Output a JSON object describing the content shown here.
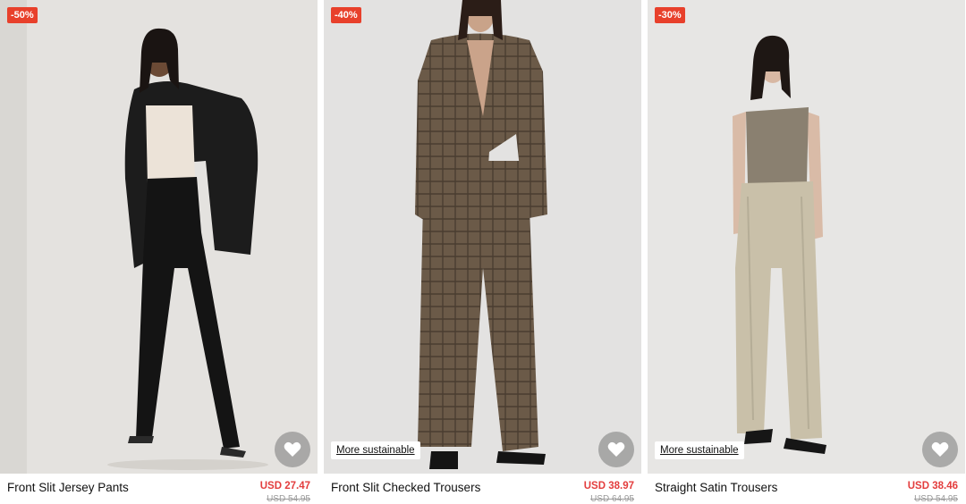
{
  "products": [
    {
      "badge": "-50%",
      "name": "Front Slit Jersey Pants",
      "price": "USD 27.47",
      "original_price": "USD 54.95",
      "sustainable_label": "",
      "photo_bg": "#e4e2df"
    },
    {
      "badge": "-40%",
      "name": "Front Slit Checked Trousers",
      "price": "USD 38.97",
      "original_price": "USD 64.95",
      "sustainable_label": "More sustainable",
      "photo_bg": "#e3e2e1"
    },
    {
      "badge": "-30%",
      "name": "Straight Satin Trousers",
      "price": "USD 38.46",
      "original_price": "USD 54.95",
      "sustainable_label": "More sustainable",
      "photo_bg": "#e7e6e4"
    }
  ],
  "colors": {
    "badge": "#e8402b",
    "sale_price": "#e33d3d",
    "wishlist_button": "#787878"
  },
  "icons": {
    "wishlist": "heart-icon"
  }
}
